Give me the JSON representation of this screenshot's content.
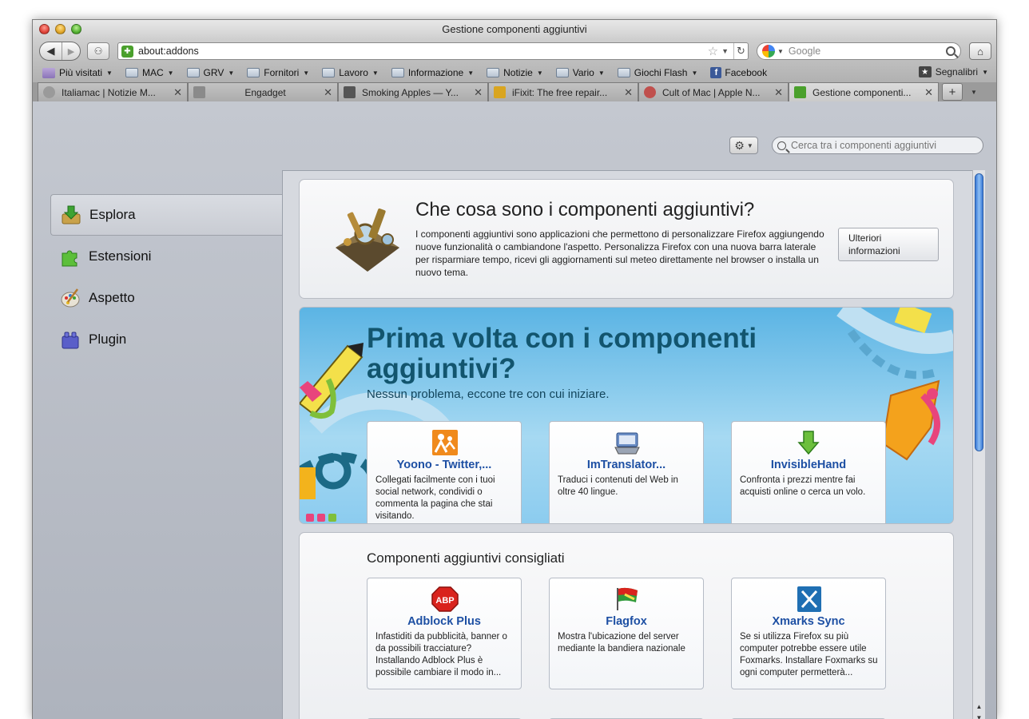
{
  "window": {
    "title": "Gestione componenti aggiuntivi"
  },
  "nav": {
    "url": "about:addons",
    "search_placeholder": "Google"
  },
  "bookmarks": {
    "items": [
      {
        "label": "Più visitati",
        "icon": "most-visited-icon",
        "dropdown": true
      },
      {
        "label": "MAC",
        "icon": "folder-icon",
        "dropdown": true
      },
      {
        "label": "GRV",
        "icon": "folder-icon",
        "dropdown": true
      },
      {
        "label": "Fornitori",
        "icon": "folder-icon",
        "dropdown": true
      },
      {
        "label": "Lavoro",
        "icon": "folder-icon",
        "dropdown": true
      },
      {
        "label": "Informazione",
        "icon": "folder-icon",
        "dropdown": true
      },
      {
        "label": "Notizie",
        "icon": "folder-icon",
        "dropdown": true
      },
      {
        "label": "Vario",
        "icon": "folder-icon",
        "dropdown": true
      },
      {
        "label": "Giochi Flash",
        "icon": "folder-icon",
        "dropdown": true
      },
      {
        "label": "Facebook",
        "icon": "facebook-icon",
        "dropdown": false
      }
    ],
    "right_label": "Segnalibri"
  },
  "tabs": [
    {
      "title": "Italiamac | Notizie M...",
      "icon": "info-icon",
      "color": "#9a9a9a",
      "active": false
    },
    {
      "title": "Engadget",
      "icon": "rss-icon",
      "color": "#8a8a8a",
      "active": false
    },
    {
      "title": "Smoking Apples — Y...",
      "icon": "sa-icon",
      "color": "#555555",
      "active": false
    },
    {
      "title": "iFixit: The free repair...",
      "icon": "ifixit-icon",
      "color": "#d9a520",
      "active": false
    },
    {
      "title": "Cult of Mac | Apple N...",
      "icon": "cult-of-mac-icon",
      "color": "#c0504d",
      "active": false
    },
    {
      "title": "Gestione componenti...",
      "icon": "puzzle-icon",
      "color": "#4aa02c",
      "active": true
    }
  ],
  "addons_manager": {
    "search_placeholder": "Cerca tra i componenti aggiuntivi",
    "categories": [
      {
        "label": "Esplora",
        "icon": "discover-icon",
        "active": true
      },
      {
        "label": "Estensioni",
        "icon": "extension-puzzle-icon",
        "active": false
      },
      {
        "label": "Aspetto",
        "icon": "appearance-palette-icon",
        "active": false
      },
      {
        "label": "Plugin",
        "icon": "plugin-brick-icon",
        "active": false
      }
    ],
    "intro": {
      "title": "Che cosa sono i componenti aggiuntivi?",
      "text": "I componenti aggiuntivi sono applicazioni che permettono di personalizzare Firefox aggiungendo nuove funzionalità o cambiandone l'aspetto. Personalizza Firefox con una nuova barra laterale per risparmiare tempo, ricevi gli aggiornamenti sul meteo direttamente nel browser o installa un nuovo tema.",
      "button_label": "Ulteriori informazioni"
    },
    "banner": {
      "title": "Prima volta con i componenti aggiuntivi?",
      "subtitle": "Nessun problema, eccone tre con cui iniziare.",
      "addons": [
        {
          "name": "Yoono - Twitter,...",
          "description": "Collegati facilmente con i tuoi social network, condividi o commenta la pagina che stai visitando.",
          "icon": "yoono-icon",
          "color": "#f08a1c"
        },
        {
          "name": "ImTranslator...",
          "description": "Traduci i contenuti del Web in oltre 40 lingue.",
          "icon": "imtranslator-icon",
          "color": "#5b7fb8"
        },
        {
          "name": "InvisibleHand",
          "description": "Confronta i prezzi mentre fai acquisti online o cerca un volo.",
          "icon": "invisiblehand-icon",
          "color": "#5aa83a"
        }
      ]
    },
    "recommended": {
      "title": "Componenti aggiuntivi consigliati",
      "addons": [
        {
          "name": "Adblock Plus",
          "description": "Infastiditi da pubblicità, banner o da possibili tracciature? Installando Adblock Plus è possibile cambiare il modo in...",
          "icon": "adblock-plus-icon",
          "icon_text": "ABP",
          "color": "#d9231d"
        },
        {
          "name": "Flagfox",
          "description": "Mostra l'ubicazione del server mediante la bandiera nazionale",
          "icon": "flagfox-icon",
          "color": "#2f9a3a"
        },
        {
          "name": "Xmarks Sync",
          "description": "Se si utilizza Firefox su più computer potrebbe essere utile Foxmarks. Installare Foxmarks su ogni computer permetterà...",
          "icon": "xmarks-icon",
          "color": "#1f6fb3"
        }
      ]
    }
  }
}
